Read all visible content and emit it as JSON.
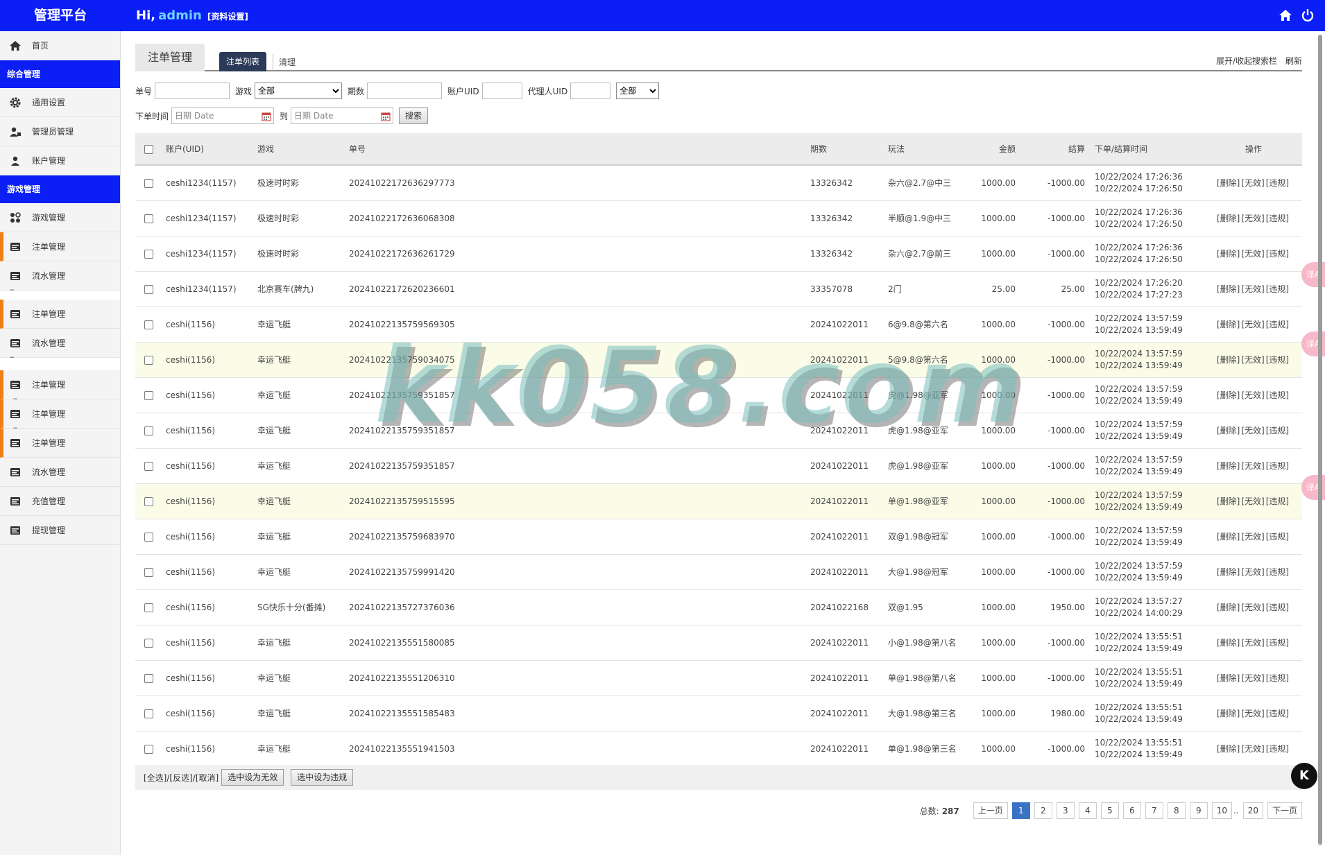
{
  "header": {
    "brand": "管理平台",
    "greeting": "Hi,",
    "username": "admin",
    "profile_link": "[资料设置]",
    "icons": [
      "home-icon",
      "power-icon"
    ]
  },
  "sidebar": {
    "home": "首页",
    "section1": "综合管理",
    "section1_items": [
      "通用设置",
      "管理员管理",
      "账户管理"
    ],
    "section2": "游戏管理",
    "section2_items": [
      "游戏管理",
      "注单管理",
      "流水管理",
      "注单管理",
      "流水管理",
      "注单管理",
      "注单管理",
      "注单管理",
      "流水管理",
      "充值管理",
      "提现管理"
    ],
    "dash": "--"
  },
  "tabs": {
    "main": "注单管理",
    "list": "注单列表",
    "clear": "清理",
    "toggle_search": "展开/收起搜索栏",
    "refresh": "刷新"
  },
  "filters": {
    "order_no": "单号",
    "game": "游戏",
    "game_selected": "全部",
    "period": "期数",
    "account_uid": "账户UID",
    "agent_uid": "代理人UID",
    "status_selected": "全部",
    "order_time": "下单时间",
    "date_placeholder": "日期 Date",
    "to": "到",
    "search": "搜索"
  },
  "table": {
    "headers": [
      "账户(UID)",
      "游戏",
      "单号",
      "期数",
      "玩法",
      "金额",
      "结算",
      "下单/结算时间",
      "操作"
    ],
    "ops": [
      "[删除]",
      "[无效]",
      "[违规]"
    ],
    "rows": [
      {
        "uid": "ceshi1234(1157)",
        "game": "极速时时彩",
        "no": "20241022172636297773",
        "period": "13326342",
        "play": "杂六@2.7@中三",
        "amount": "1000.00",
        "settle": "-1000.00",
        "t1": "10/22/2024 17:26:36",
        "t2": "10/22/2024 17:26:50"
      },
      {
        "uid": "ceshi1234(1157)",
        "game": "极速时时彩",
        "no": "20241022172636068308",
        "period": "13326342",
        "play": "半顺@1.9@中三",
        "amount": "1000.00",
        "settle": "-1000.00",
        "t1": "10/22/2024 17:26:36",
        "t2": "10/22/2024 17:26:50"
      },
      {
        "uid": "ceshi1234(1157)",
        "game": "极速时时彩",
        "no": "20241022172636261729",
        "period": "13326342",
        "play": "杂六@2.7@前三",
        "amount": "1000.00",
        "settle": "-1000.00",
        "t1": "10/22/2024 17:26:36",
        "t2": "10/22/2024 17:26:50"
      },
      {
        "uid": "ceshi1234(1157)",
        "game": "北京赛车(牌九)",
        "no": "20241022172620236601",
        "period": "33357078",
        "play": "2门",
        "amount": "25.00",
        "settle": "25.00",
        "t1": "10/22/2024 17:26:20",
        "t2": "10/22/2024 17:27:23"
      },
      {
        "uid": "ceshi(1156)",
        "game": "幸运飞艇",
        "no": "20241022135759569305",
        "period": "20241022011",
        "play": "6@9.8@第六名",
        "amount": "1000.00",
        "settle": "-1000.00",
        "t1": "10/22/2024 13:57:59",
        "t2": "10/22/2024 13:59:49"
      },
      {
        "uid": "ceshi(1156)",
        "game": "幸运飞艇",
        "no": "20241022135759034075",
        "period": "20241022011",
        "play": "5@9.8@第六名",
        "amount": "1000.00",
        "settle": "-1000.00",
        "t1": "10/22/2024 13:57:59",
        "t2": "10/22/2024 13:59:49"
      },
      {
        "uid": "ceshi(1156)",
        "game": "幸运飞艇",
        "no": "20241022135759351857",
        "period": "20241022011",
        "play": "虎@1.98@亚军",
        "amount": "1000.00",
        "settle": "-1000.00",
        "t1": "10/22/2024 13:57:59",
        "t2": "10/22/2024 13:59:49"
      },
      {
        "uid": "ceshi(1156)",
        "game": "幸运飞艇",
        "no": "20241022135759351857",
        "period": "20241022011",
        "play": "虎@1.98@亚军",
        "amount": "1000.00",
        "settle": "-1000.00",
        "t1": "10/22/2024 13:57:59",
        "t2": "10/22/2024 13:59:49"
      },
      {
        "uid": "ceshi(1156)",
        "game": "幸运飞艇",
        "no": "20241022135759351857",
        "period": "20241022011",
        "play": "虎@1.98@亚军",
        "amount": "1000.00",
        "settle": "-1000.00",
        "t1": "10/22/2024 13:57:59",
        "t2": "10/22/2024 13:59:49"
      },
      {
        "uid": "ceshi(1156)",
        "game": "幸运飞艇",
        "no": "20241022135759515595",
        "period": "20241022011",
        "play": "单@1.98@亚军",
        "amount": "1000.00",
        "settle": "-1000.00",
        "t1": "10/22/2024 13:57:59",
        "t2": "10/22/2024 13:59:49"
      },
      {
        "uid": "ceshi(1156)",
        "game": "幸运飞艇",
        "no": "20241022135759683970",
        "period": "20241022011",
        "play": "双@1.98@冠军",
        "amount": "1000.00",
        "settle": "-1000.00",
        "t1": "10/22/2024 13:57:59",
        "t2": "10/22/2024 13:59:49"
      },
      {
        "uid": "ceshi(1156)",
        "game": "幸运飞艇",
        "no": "20241022135759991420",
        "period": "20241022011",
        "play": "大@1.98@冠军",
        "amount": "1000.00",
        "settle": "-1000.00",
        "t1": "10/22/2024 13:57:59",
        "t2": "10/22/2024 13:59:49"
      },
      {
        "uid": "ceshi(1156)",
        "game": "SG快乐十分(番摊)",
        "no": "20241022135727376036",
        "period": "20241022168",
        "play": "双@1.95",
        "amount": "1000.00",
        "settle": "1950.00",
        "t1": "10/22/2024 13:57:27",
        "t2": "10/22/2024 14:00:29"
      },
      {
        "uid": "ceshi(1156)",
        "game": "幸运飞艇",
        "no": "20241022135551580085",
        "period": "20241022011",
        "play": "小@1.98@第八名",
        "amount": "1000.00",
        "settle": "-1000.00",
        "t1": "10/22/2024 13:55:51",
        "t2": "10/22/2024 13:59:49"
      },
      {
        "uid": "ceshi(1156)",
        "game": "幸运飞艇",
        "no": "20241022135551206310",
        "period": "20241022011",
        "play": "单@1.98@第八名",
        "amount": "1000.00",
        "settle": "-1000.00",
        "t1": "10/22/2024 13:55:51",
        "t2": "10/22/2024 13:59:49"
      },
      {
        "uid": "ceshi(1156)",
        "game": "幸运飞艇",
        "no": "20241022135551585483",
        "period": "20241022011",
        "play": "大@1.98@第三名",
        "amount": "1000.00",
        "settle": "1980.00",
        "t1": "10/22/2024 13:55:51",
        "t2": "10/22/2024 13:59:49"
      },
      {
        "uid": "ceshi(1156)",
        "game": "幸运飞艇",
        "no": "20241022135551941503",
        "period": "20241022011",
        "play": "单@1.98@第三名",
        "amount": "1000.00",
        "settle": "-1000.00",
        "t1": "10/22/2024 13:55:51",
        "t2": "10/22/2024 13:59:49"
      }
    ]
  },
  "bottom": {
    "selectors": "[全选]/[反选]/[取消]",
    "set_invalid": "选中设为无效",
    "set_violation": "选中设为违规"
  },
  "pager": {
    "total_label": "总数:",
    "total": "287",
    "prev": "上一页",
    "pages": [
      "1",
      "2",
      "3",
      "4",
      "5",
      "6",
      "7",
      "8",
      "9",
      "10"
    ],
    "ellipsis": "..",
    "last": "20",
    "next": "下一页",
    "current": "1"
  },
  "watermark": "kk058.com",
  "side_badge": "译A",
  "float_button": "K",
  "colors": {
    "header_bg": "#0a1ef5",
    "accent_orange": "#f07f18",
    "active_tab": "#2a3a58",
    "page_active": "#3a73c5"
  }
}
